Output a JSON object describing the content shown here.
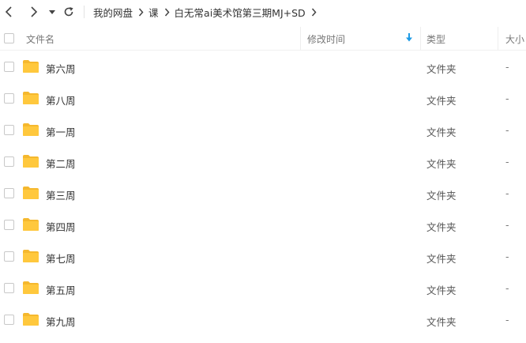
{
  "toolbar": {
    "back_icon": "chevron-left-icon",
    "forward_icon": "chevron-right-icon",
    "history_icon": "caret-down-icon",
    "refresh_icon": "refresh-icon"
  },
  "breadcrumb": [
    "我的网盘",
    "课",
    "白无常ai美术馆第三期MJ+SD"
  ],
  "columns": {
    "name": "文件名",
    "modified": "修改时间",
    "type": "类型",
    "size": "大小"
  },
  "rows": [
    {
      "name": "第六周",
      "modified": "",
      "type": "文件夹",
      "size": "-"
    },
    {
      "name": "第八周",
      "modified": "",
      "type": "文件夹",
      "size": "-"
    },
    {
      "name": "第一周",
      "modified": "",
      "type": "文件夹",
      "size": "-"
    },
    {
      "name": "第二周",
      "modified": "",
      "type": "文件夹",
      "size": "-"
    },
    {
      "name": "第三周",
      "modified": "",
      "type": "文件夹",
      "size": "-"
    },
    {
      "name": "第四周",
      "modified": "",
      "type": "文件夹",
      "size": "-"
    },
    {
      "name": "第七周",
      "modified": "",
      "type": "文件夹",
      "size": "-"
    },
    {
      "name": "第五周",
      "modified": "",
      "type": "文件夹",
      "size": "-"
    },
    {
      "name": "第九周",
      "modified": "",
      "type": "文件夹",
      "size": "-"
    }
  ],
  "colors": {
    "folder": "#FFC83D",
    "sort_accent": "#1E9BE6"
  }
}
